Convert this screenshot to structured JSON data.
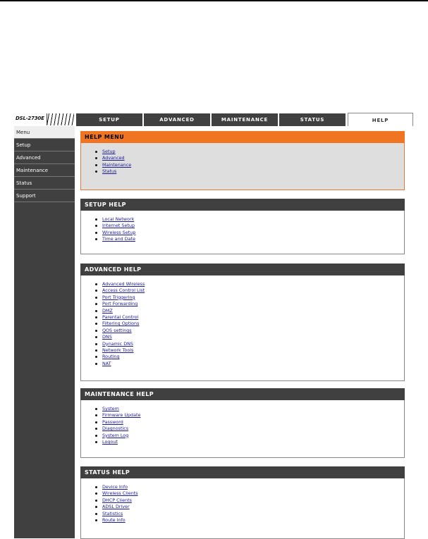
{
  "model": "DSL-2730E",
  "tabs": [
    {
      "label": "SETUP"
    },
    {
      "label": "ADVANCED"
    },
    {
      "label": "MAINTENANCE"
    },
    {
      "label": "STATUS"
    },
    {
      "label": "HELP",
      "active": true
    }
  ],
  "sidebar": {
    "items": [
      {
        "label": "Menu",
        "active": true
      },
      {
        "label": "Setup"
      },
      {
        "label": "Advanced"
      },
      {
        "label": "Maintenance"
      },
      {
        "label": "Status"
      },
      {
        "label": "Support"
      }
    ]
  },
  "sections": {
    "help_menu": {
      "title": "HELP MENU",
      "links": [
        "Setup",
        "Advanced",
        "Maintenance",
        "Status"
      ]
    },
    "setup_help": {
      "title": "SETUP HELP",
      "links": [
        "Local Network",
        "Internet Setup",
        "Wireless Setup",
        "Time and Date"
      ]
    },
    "advanced_help": {
      "title": "ADVANCED HELP",
      "links": [
        "Advanced Wireless",
        "Access Control List",
        "Port Triggering",
        "Port Forwarding",
        "DMZ",
        "Parental Control",
        "Filtering Options",
        "QOS settings",
        "DNS",
        "Dynamic DNS",
        "Network Tools",
        "Routing",
        "NAT"
      ]
    },
    "maintenance_help": {
      "title": "MAINTENANCE HELP",
      "links": [
        "System",
        "Firmware Update",
        "Password",
        "Diagnostics",
        "System Log",
        "Logout"
      ]
    },
    "status_help": {
      "title": "STATUS HELP",
      "links": [
        "Device Info",
        "Wireless Clients",
        "DHCP Clients",
        "ADSL Driver",
        "Statistics",
        "Route Info"
      ]
    }
  },
  "colors": {
    "dark": "#404040",
    "orange": "#f07522",
    "link": "#1a1a99"
  }
}
